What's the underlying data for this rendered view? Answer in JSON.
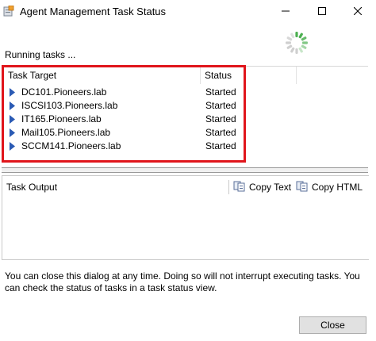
{
  "window": {
    "title": "Agent Management Task Status"
  },
  "running": {
    "label": "Running tasks ..."
  },
  "task_table": {
    "columns": [
      "Task Target",
      "Status"
    ],
    "rows": [
      {
        "target": "DC101.Pioneers.lab",
        "status": "Started"
      },
      {
        "target": "ISCSI103.Pioneers.lab",
        "status": "Started"
      },
      {
        "target": "IT165.Pioneers.lab",
        "status": "Started"
      },
      {
        "target": "Mail105.Pioneers.lab",
        "status": "Started"
      },
      {
        "target": "SCCM141.Pioneers.lab",
        "status": "Started"
      }
    ]
  },
  "output": {
    "label": "Task Output",
    "copy_text_label": "Copy Text",
    "copy_html_label": "Copy HTML"
  },
  "info": {
    "message": "You can close this dialog at any time. Doing so will not interrupt executing tasks. You can check the status of tasks in a task status view."
  },
  "footer": {
    "close_label": "Close"
  },
  "colors": {
    "highlight": "#e0151b",
    "spinner_active": "#4caf50",
    "row_arrow": "#2a5ab4"
  },
  "icons": {
    "app": "task-status-icon",
    "minimize": "minimize-icon",
    "maximize": "maximize-icon",
    "close": "close-icon",
    "spinner": "loading-spinner-icon",
    "row": "expand-arrow-icon",
    "copy": "copy-icon"
  }
}
